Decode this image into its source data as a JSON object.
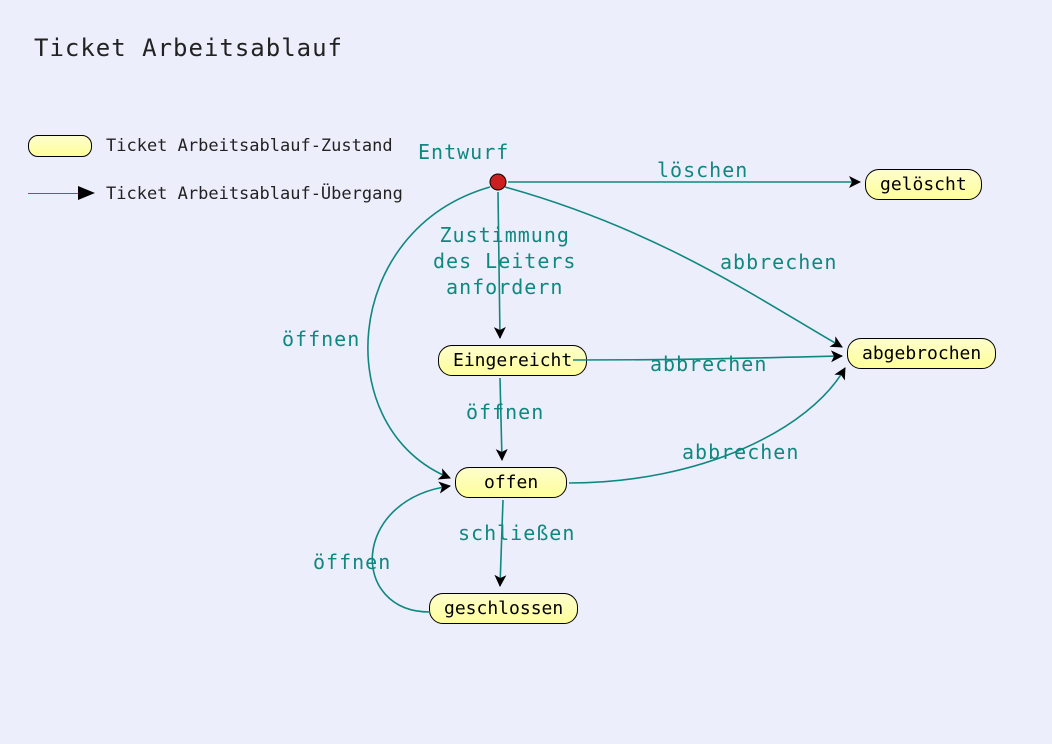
{
  "title": "Ticket Arbeitsablauf",
  "legend": {
    "state_label": "Ticket Arbeitsablauf-Zustand",
    "transition_label": "Ticket Arbeitsablauf-Übergang"
  },
  "initial": "Entwurf",
  "states": {
    "eingereicht": "Eingereicht",
    "offen": "offen",
    "geschlossen": "geschlossen",
    "geloescht": "gelöscht",
    "abgebrochen": "abgebrochen"
  },
  "transitions": {
    "entwurf_loeschen": "löschen",
    "entwurf_abbrechen": "abbrechen",
    "entwurf_zustimmung": "Zustimmung\ndes Leiters\nanfordern",
    "entwurf_oeffnen": "öffnen",
    "eingereicht_oeffnen": "öffnen",
    "eingereicht_abbrechen": "abbrechen",
    "offen_schliessen": "schließen",
    "offen_abbrechen": "abbrechen",
    "geschlossen_oeffnen": "öffnen"
  }
}
